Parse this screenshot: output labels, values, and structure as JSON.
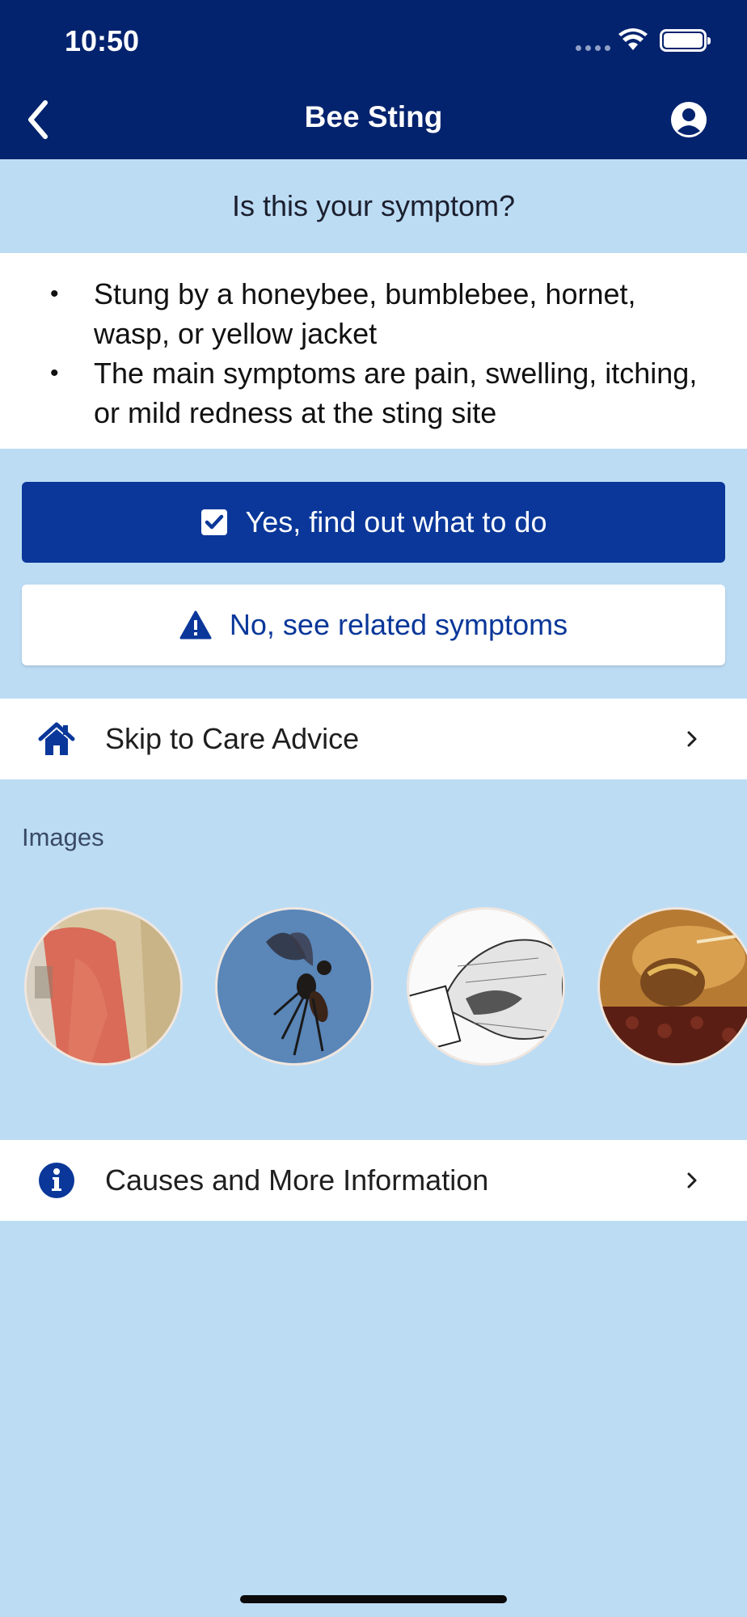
{
  "status_bar": {
    "time": "10:50"
  },
  "nav": {
    "title": "Bee Sting",
    "back_icon": "chevron-left-icon",
    "profile_icon": "user-circle-icon"
  },
  "question": "Is this your symptom?",
  "symptoms": [
    "Stung by a honeybee, bumblebee, hornet, wasp, or yellow jacket",
    "The main symptoms are pain, swelling, itching, or mild redness at the sting site"
  ],
  "actions": {
    "yes_label": "Yes, find out what to do",
    "yes_icon": "checkbox-checked-icon",
    "no_label": "No, see related symptoms",
    "no_icon": "warning-triangle-icon"
  },
  "skip_row": {
    "label": "Skip to Care Advice",
    "icon": "home-icon"
  },
  "images": {
    "label": "Images",
    "items": [
      "arm-sting-photo",
      "wasp-photo",
      "stinger-removal-drawing",
      "honeybee-photo"
    ]
  },
  "causes_row": {
    "label": "Causes and More Information",
    "icon": "info-circle-icon"
  },
  "colors": {
    "header": "#04236e",
    "primary_button": "#0a3799",
    "page_background": "#bcdcf4"
  }
}
